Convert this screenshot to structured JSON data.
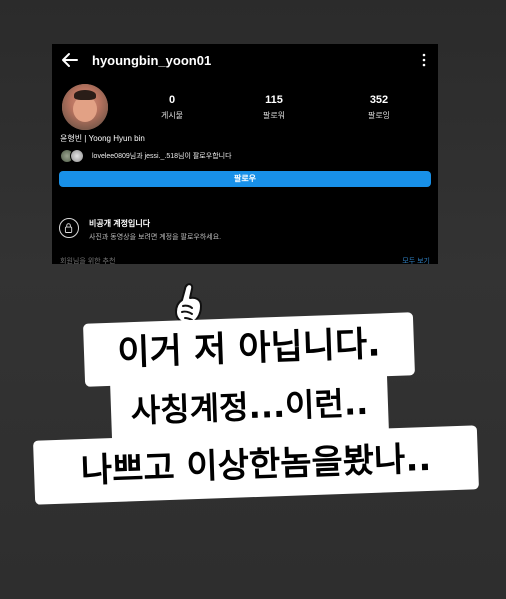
{
  "profile": {
    "username": "hyoungbin_yoon01",
    "posts_count": "0",
    "posts_label": "게시물",
    "followers_count": "115",
    "followers_label": "팔로워",
    "following_count": "352",
    "following_label": "팔로잉",
    "bio_name": "윤형빈 | Yoong Hyun bin",
    "followed_by_text": "lovelee0809님과 jessi._.518님이 팔로우합니다",
    "follow_button_label": "팔로우",
    "private_title": "비공개 계정입니다",
    "private_subtitle": "사진과 동영상을 보려면 계정을 팔로우하세요.",
    "cut_left_text": "회원님을 위한 추천",
    "cut_right_text": "모두 보기"
  },
  "caption": {
    "line1": "이거 저 아닙니다.",
    "line2": "사칭계정...이런..",
    "line3": "나쁘고 이상한놈을봤나.."
  },
  "colors": {
    "follow_button": "#1890e8",
    "background": "#2e2e2e",
    "screenshot_bg": "#000000",
    "caption_bg": "#ffffff"
  },
  "icons": {
    "back": "arrow-left-icon",
    "more": "more-vertical-icon",
    "lock": "lock-icon",
    "emoji": "pointing-up-hand-emoji"
  }
}
